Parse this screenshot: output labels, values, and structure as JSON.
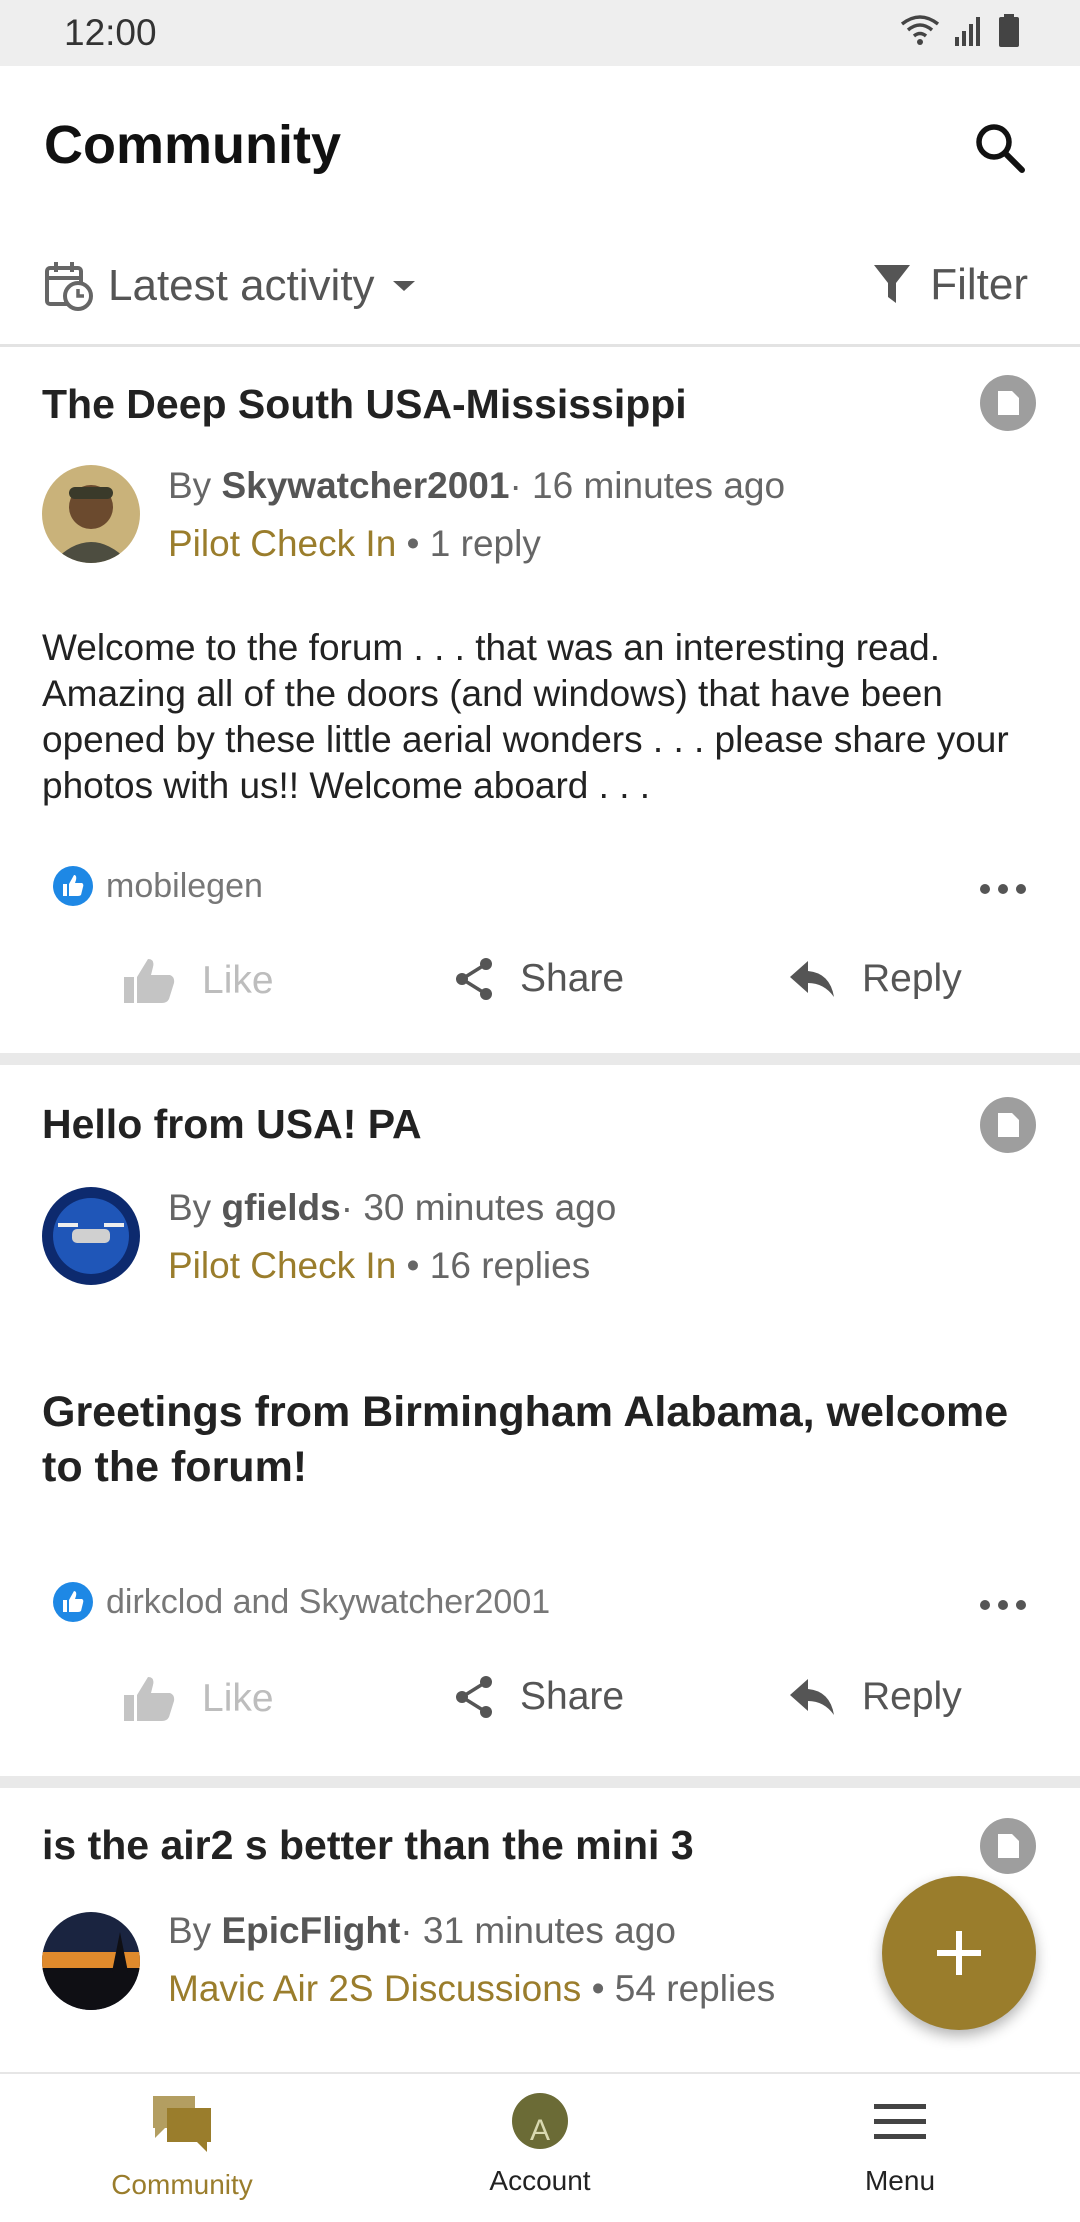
{
  "status": {
    "time": "12:00"
  },
  "header": {
    "title": "Community"
  },
  "sort": {
    "label": "Latest activity",
    "filter_label": "Filter"
  },
  "posts": [
    {
      "title": "The Deep South USA-Mississippi",
      "by": "By ",
      "author": "Skywatcher2001",
      "time": "· 16 minutes ago",
      "forum": "Pilot Check In",
      "replies": " • 1 reply",
      "body": "Welcome to the forum . . . that was an interesting read. Amazing all of the doors (and windows) that have been opened by these little aerial wonders . . . please share your photos with us!! Welcome aboard . . .",
      "likers": "mobilegen"
    },
    {
      "title": "Hello from USA!  PA",
      "by": "By ",
      "author": "gfields",
      "time": "· 30 minutes ago",
      "forum": "Pilot Check In",
      "replies": " • 16 replies",
      "body": "Greetings from Birmingham Alabama, welcome to the forum!",
      "likers": "dirkclod and Skywatcher2001"
    },
    {
      "title": "is the air2 s better than the mini 3",
      "by": "By ",
      "author": "EpicFlight",
      "time": "· 31 minutes ago",
      "forum": "Mavic Air 2S Discussions",
      "replies": " • 54 replies"
    }
  ],
  "actions": {
    "like": "Like",
    "share": "Share",
    "reply": "Reply"
  },
  "nav": {
    "community": "Community",
    "account": "Account",
    "account_initial": "A",
    "menu": "Menu"
  },
  "colors": {
    "accent": "#9a7d2c",
    "like_blue": "#1e88e5",
    "divider": "#e9e9e9"
  }
}
